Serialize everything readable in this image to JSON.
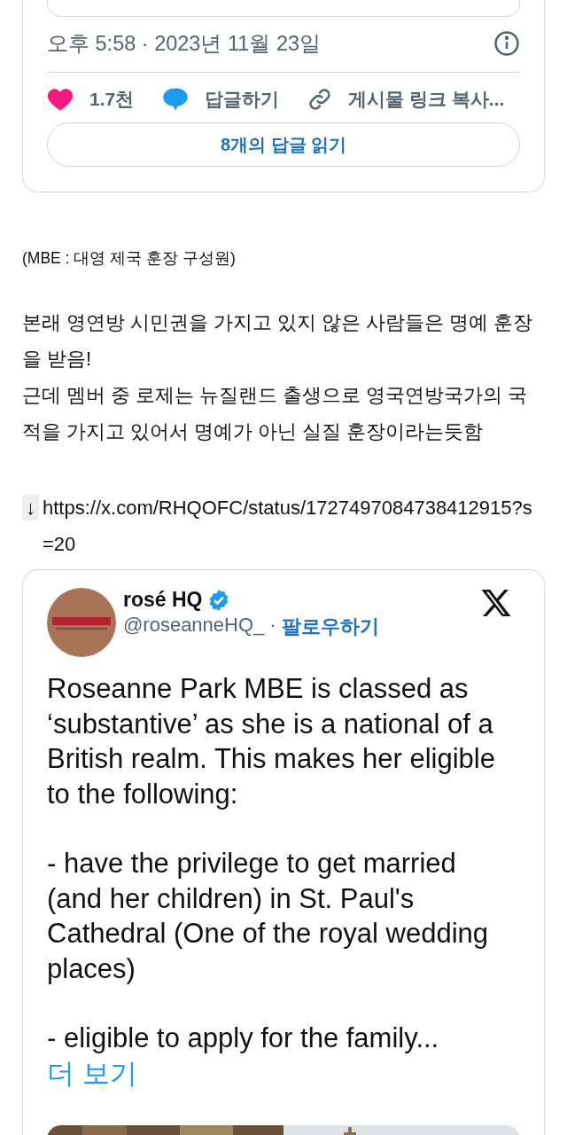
{
  "top_post": {
    "timestamp": "오후 5:58 · 2023년 11월 23일",
    "actions": [
      {
        "kind": "like",
        "label": "1.7천"
      },
      {
        "kind": "reply",
        "label": "답글하기"
      },
      {
        "kind": "link",
        "label": "게시물 링크 복사..."
      }
    ],
    "read_replies": "8개의 답글 읽기"
  },
  "note": "(MBE : 대영 제국 훈장 구성원)",
  "body": "본래 영연방 시민권을 가지고 있지 않은 사람들은 명예 훈장을 받음!\n근데 멤버 중 로제는 뉴질랜드 출생으로 영국연방국가의 국적을 가지고 있어서 명예가 아닌 실질 훈장이라는듯함",
  "link_line": {
    "arrow": "↓",
    "url": "https://x.com/RHQOFC/status/1727497084738412915?s=20"
  },
  "embedded_post": {
    "name": "rosé HQ",
    "verified": true,
    "handle": "@roseanneHQ_",
    "separator": "·",
    "follow": "팔로우하기",
    "paragraphs": [
      "Roseanne Park MBE is classed as ‘substantive’ as she is a national of a British realm. This makes her eligible to the following:",
      "- have the privilege to get married (and her children) in St. Paul's Cathedral (One of the royal wedding places)",
      "- eligible to apply for the family..."
    ],
    "more": "더 보기"
  }
}
